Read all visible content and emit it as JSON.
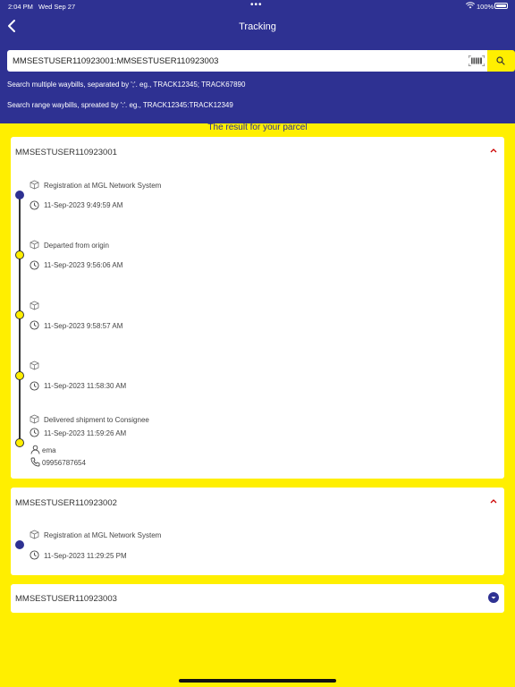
{
  "status_bar": {
    "time": "2:04 PM",
    "date": "Wed Sep 27",
    "battery": "100%"
  },
  "header": {
    "title": "Tracking"
  },
  "search": {
    "value": "MMSESTUSER110923001:MMSESTUSER110923003"
  },
  "hints": {
    "multiple": "Search multiple waybills, separated by ';'. eg., TRACK12345; TRACK67890",
    "range": "Search range waybills, spreated by ':'. eg., TRACK12345:TRACK12349"
  },
  "result_title": "The result for your parcel",
  "parcels": [
    {
      "waybill": "MMSESTUSER110923001",
      "expanded": true,
      "events": [
        {
          "status": "Registration at MGL Network System",
          "time": "11-Sep-2023 9:49:59 AM"
        },
        {
          "status": "Departed from origin",
          "time": "11-Sep-2023 9:56:06 AM"
        },
        {
          "status": "",
          "time": "11-Sep-2023 9:58:57 AM"
        },
        {
          "status": "",
          "time": "11-Sep-2023 11:58:30 AM"
        },
        {
          "status": "Delivered shipment to Consignee",
          "time": "11-Sep-2023 11:59:26 AM",
          "receiver": "ema",
          "phone": "09956787654"
        }
      ]
    },
    {
      "waybill": "MMSESTUSER110923002",
      "expanded": true,
      "events": [
        {
          "status": "Registration at MGL Network System",
          "time": "11-Sep-2023 11:29:25 PM"
        }
      ]
    },
    {
      "waybill": "MMSESTUSER110923003",
      "expanded": false,
      "events": []
    }
  ],
  "colors": {
    "primary": "#2e3192",
    "accent": "#ffef00",
    "chevron": "#cc0000"
  },
  "icons": [
    "back-icon",
    "barcode-icon",
    "search-icon",
    "package-icon",
    "clock-icon",
    "person-icon",
    "phone-icon",
    "chevron-up-icon",
    "chevron-down-icon"
  ]
}
